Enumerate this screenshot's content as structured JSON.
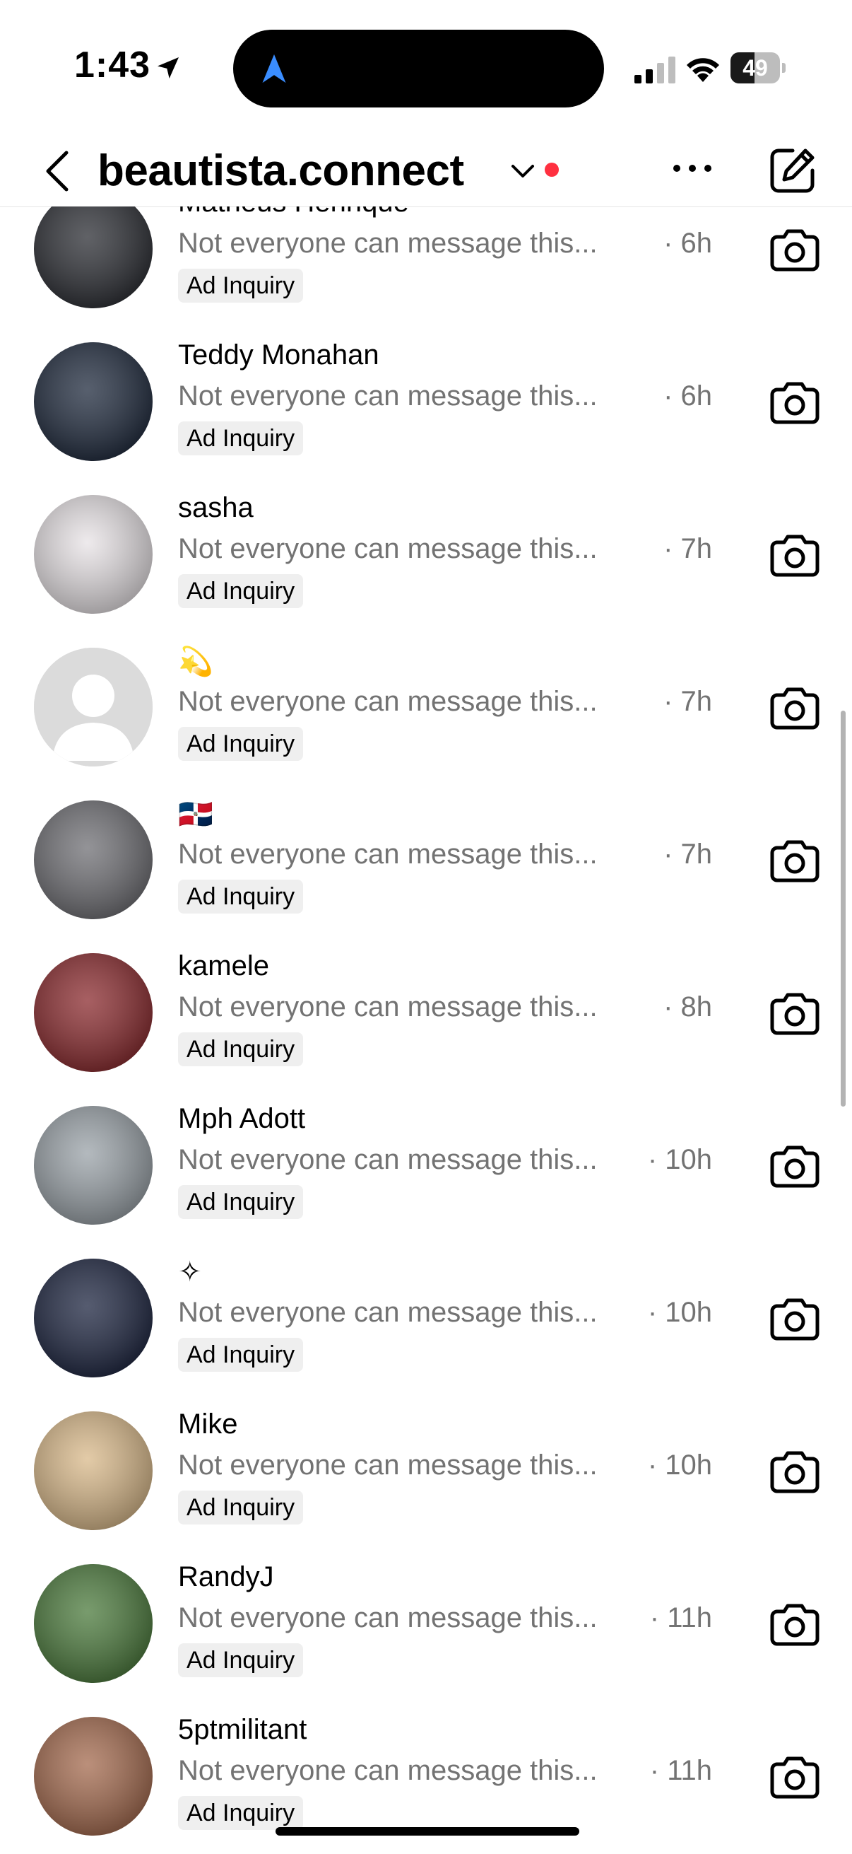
{
  "status_bar": {
    "time": "1:43",
    "battery": "49",
    "battery_level": 0.49
  },
  "header": {
    "account": "beautista.connect"
  },
  "conversations": [
    {
      "name": "Matheus Henrique",
      "preview": "Not everyone can message this...",
      "time": "· 6h",
      "tag": "Ad Inquiry",
      "avatar_color": "#2b2d33"
    },
    {
      "name": "Teddy Monahan",
      "preview": "Not everyone can message this...",
      "time": "· 6h",
      "tag": "Ad Inquiry",
      "avatar_color": "#1f2a3d"
    },
    {
      "name": "sasha",
      "preview": "Not everyone can message this...",
      "time": "· 7h",
      "tag": "Ad Inquiry",
      "avatar_color": "#e8e3e6"
    },
    {
      "name": "💫",
      "preview": "Not everyone can message this...",
      "time": "· 7h",
      "tag": "Ad Inquiry",
      "avatar_color": "#dbdbdb"
    },
    {
      "name": "🇩🇴",
      "preview": "Not everyone can message this...",
      "time": "· 7h",
      "tag": "Ad Inquiry",
      "avatar_color": "#6f6f74"
    },
    {
      "name": "kamele",
      "preview": "Not everyone can message this...",
      "time": "· 8h",
      "tag": "Ad Inquiry",
      "avatar_color": "#8a2a2e"
    },
    {
      "name": "Mph Adott",
      "preview": "Not everyone can message this...",
      "time": "· 10h",
      "tag": "Ad Inquiry",
      "avatar_color": "#9aa2a8"
    },
    {
      "name": "✧",
      "preview": "Not everyone can message this...",
      "time": "· 10h",
      "tag": "Ad Inquiry",
      "avatar_color": "#1d2540"
    },
    {
      "name": "Mike",
      "preview": "Not everyone can message this...",
      "time": "· 10h",
      "tag": "Ad Inquiry",
      "avatar_color": "#d9b98a"
    },
    {
      "name": "RandyJ",
      "preview": "Not everyone can message this...",
      "time": "· 11h",
      "tag": "Ad Inquiry",
      "avatar_color": "#4b7a3c"
    },
    {
      "name": "5ptmilitant",
      "preview": "Not everyone can message this...",
      "time": "· 11h",
      "tag": "Ad Inquiry",
      "avatar_color": "#a46a4e"
    }
  ],
  "icons": {
    "location": "location-arrow-icon",
    "navigation": "navigation-arrow-icon",
    "back": "chevron-left-icon",
    "dropdown": "chevron-down-icon",
    "more": "more-horizontal-icon",
    "compose": "compose-icon",
    "camera": "camera-icon"
  },
  "colors": {
    "notification_dot": "#ff3040",
    "secondary_text": "#737373",
    "nav_blue": "#3a8dff"
  }
}
